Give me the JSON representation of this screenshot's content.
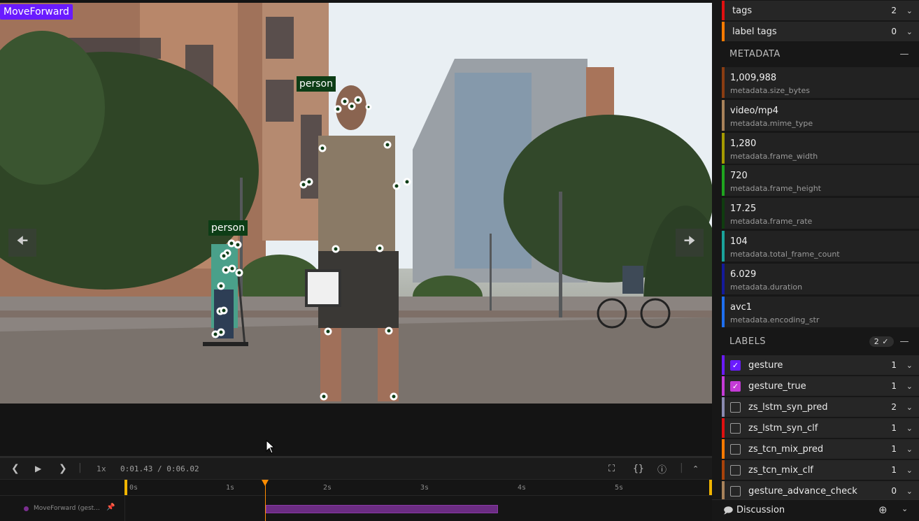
{
  "video": {
    "title_chip": "MoveForward",
    "detections": [
      {
        "label": "person"
      },
      {
        "label": "person"
      }
    ]
  },
  "controls": {
    "speed": "1x",
    "time_current": "0:01.43",
    "time_sep": "/",
    "time_total": "0:06.02",
    "ticks": [
      "0s",
      "1s",
      "2s",
      "3s",
      "4s",
      "5s"
    ],
    "track_label": "MoveForward (gest..."
  },
  "sidebar": {
    "tags": {
      "label": "tags",
      "count": "2"
    },
    "label_tags": {
      "label": "label tags",
      "count": "0"
    },
    "metadata_title": "METADATA",
    "metadata": [
      {
        "value": "1,009,988",
        "key": "metadata.size_bytes",
        "color": "#8a3d12"
      },
      {
        "value": "video/mp4",
        "key": "metadata.mime_type",
        "color": "#a8825a"
      },
      {
        "value": "1,280",
        "key": "metadata.frame_width",
        "color": "#a59a00"
      },
      {
        "value": "720",
        "key": "metadata.frame_height",
        "color": "#1fa51f"
      },
      {
        "value": "17.25",
        "key": "metadata.frame_rate",
        "color": "#0f3d0f"
      },
      {
        "value": "104",
        "key": "metadata.total_frame_count",
        "color": "#1aa39b"
      },
      {
        "value": "6.029",
        "key": "metadata.duration",
        "color": "#141a9a"
      },
      {
        "value": "avc1",
        "key": "metadata.encoding_str",
        "color": "#1e6ff0"
      }
    ],
    "labels_title": "LABELS",
    "labels_badge": "2 ✓",
    "labels": [
      {
        "name": "gesture",
        "count": "1",
        "checked": true,
        "color": "#6a1bff"
      },
      {
        "name": "gesture_true",
        "count": "1",
        "checked": true,
        "color": "#c43bd6"
      },
      {
        "name": "zs_lstm_syn_pred",
        "count": "2",
        "checked": false,
        "color": "#8a8ab0"
      },
      {
        "name": "zs_lstm_syn_clf",
        "count": "1",
        "checked": false,
        "color": "#e01010"
      },
      {
        "name": "zs_tcn_mix_pred",
        "count": "1",
        "checked": false,
        "color": "#ff7a00"
      },
      {
        "name": "zs_tcn_mix_clf",
        "count": "1",
        "checked": false,
        "color": "#a8420a"
      },
      {
        "name": "gesture_advance_check",
        "count": "0",
        "checked": false,
        "color": "#a8825a"
      }
    ],
    "discussion": "Discussion"
  },
  "colors": {
    "tags_bar": "#e01010",
    "label_tags_bar": "#ff7a00",
    "accent": "#6a1bff",
    "playhead": "#ff8c00",
    "segment": "#6b2c83"
  }
}
